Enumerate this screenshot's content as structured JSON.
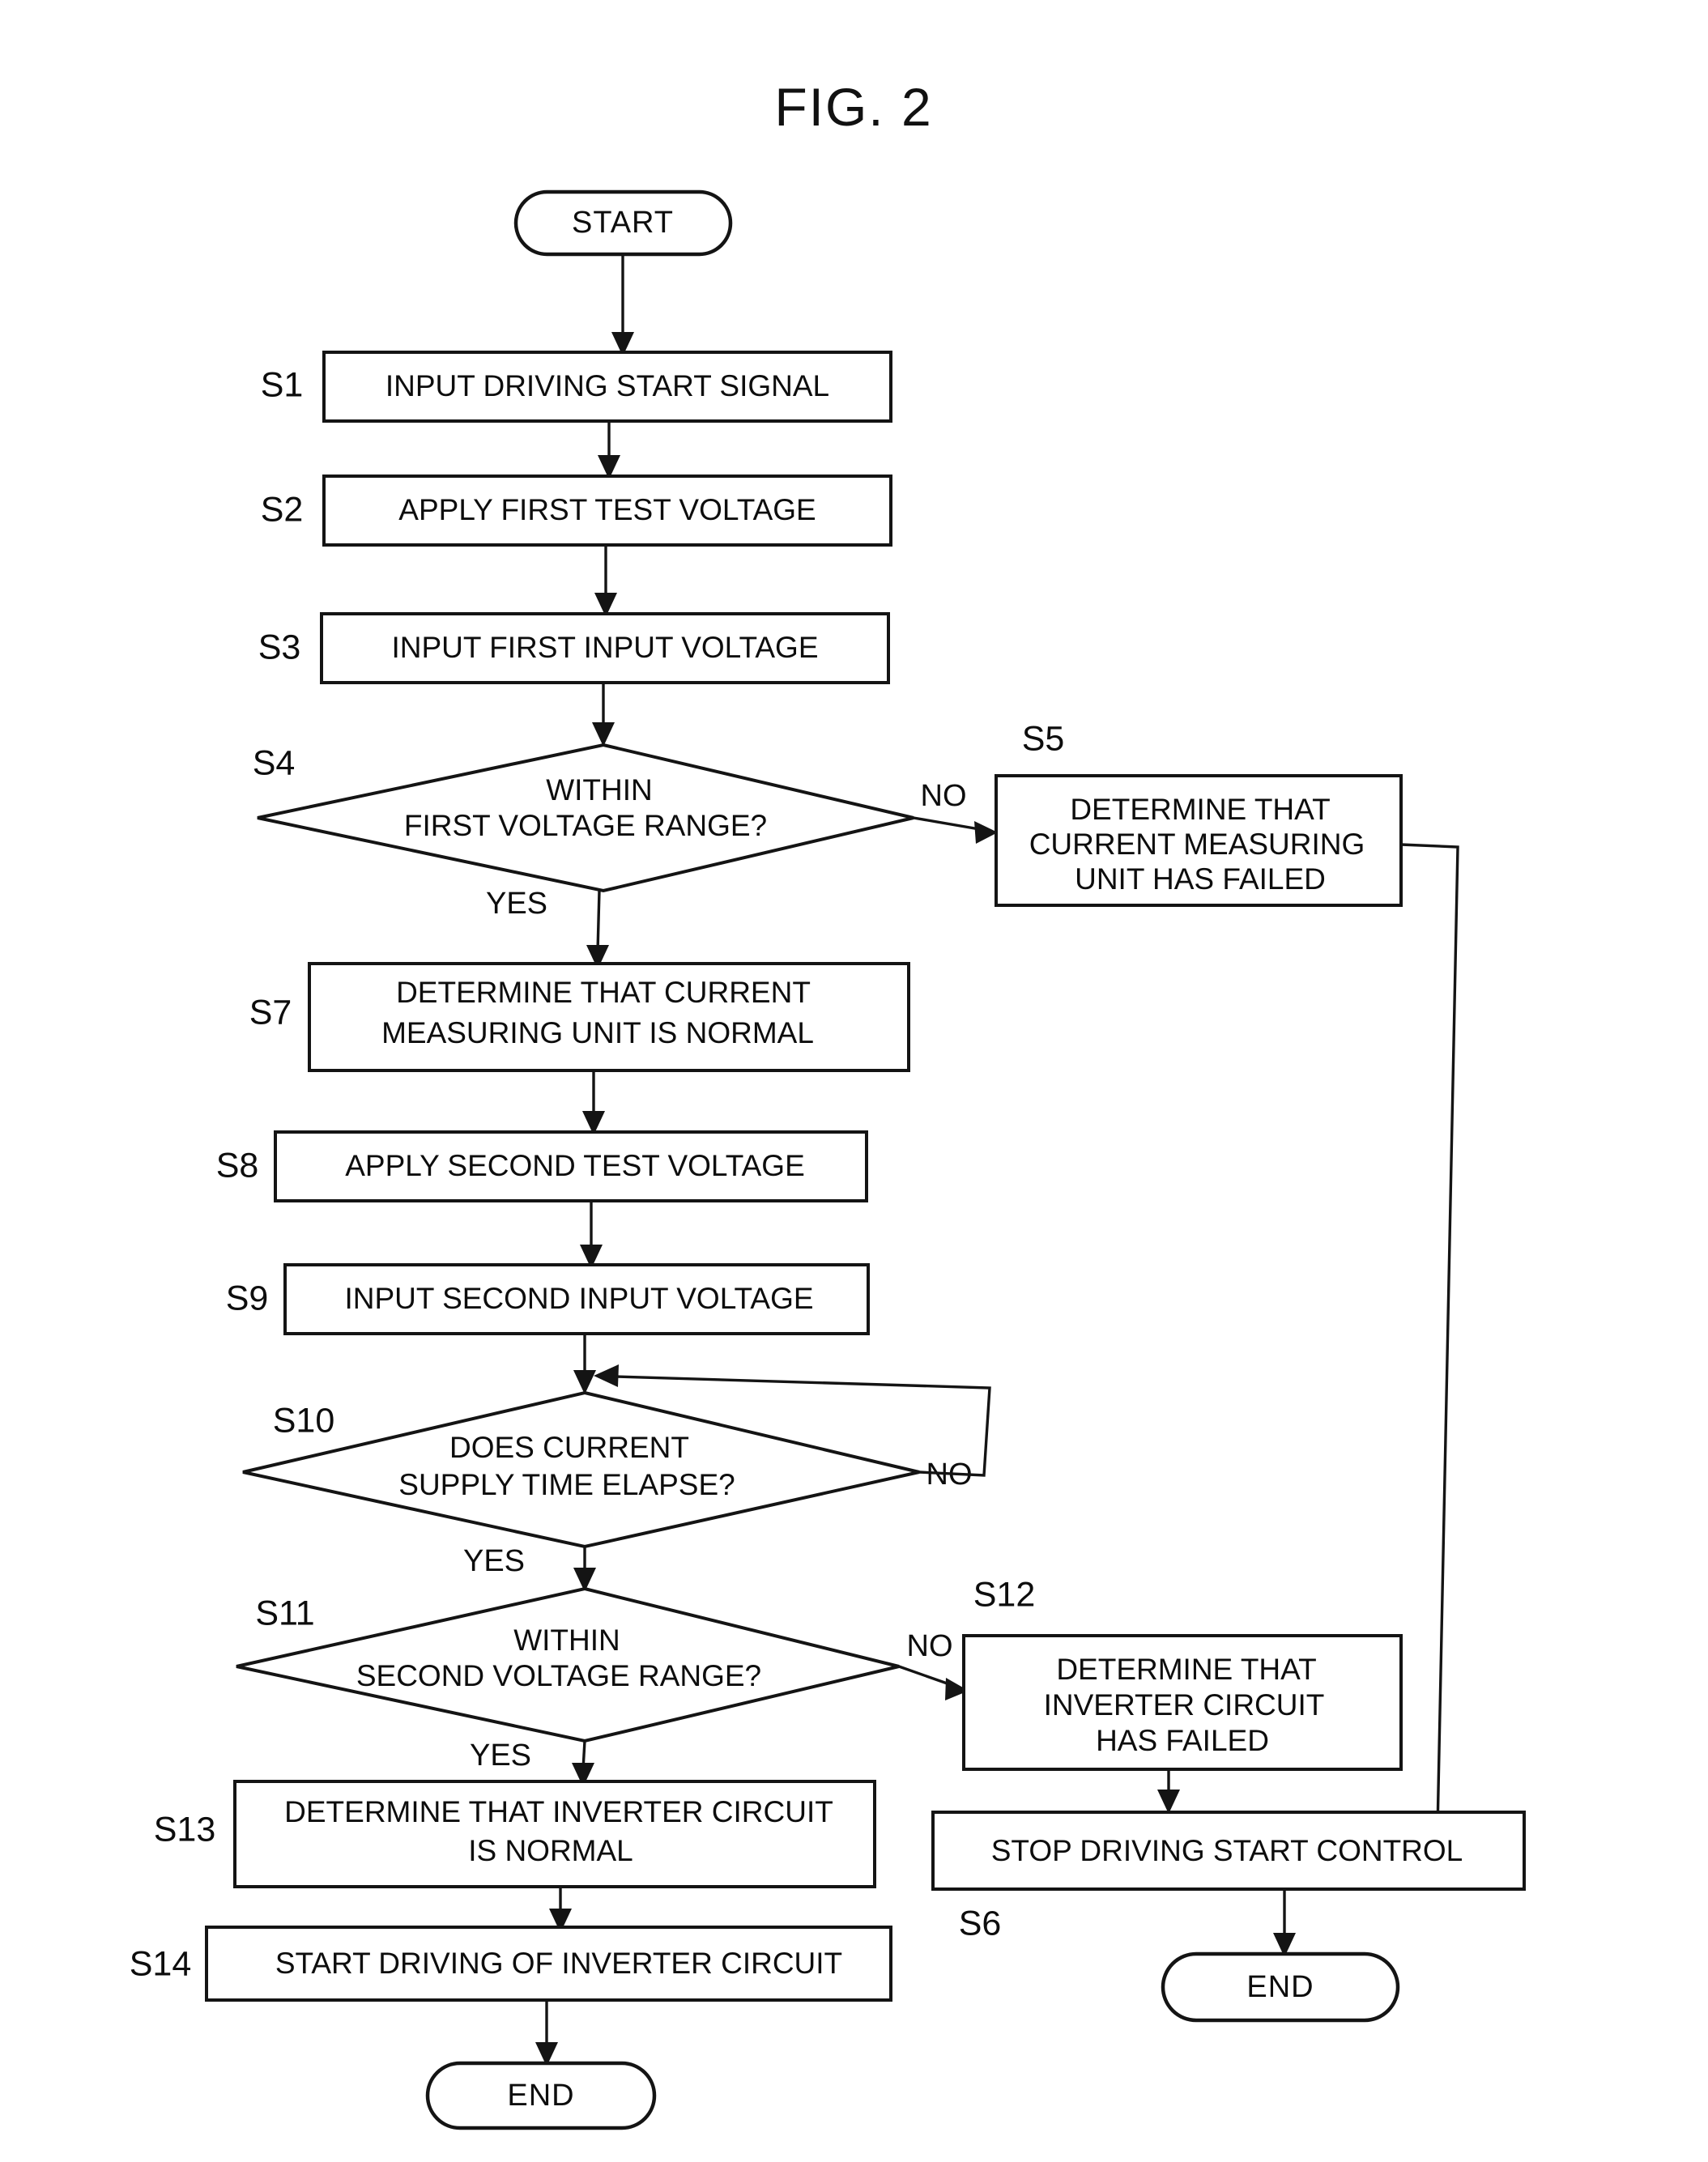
{
  "figure": {
    "title": "FIG. 2",
    "type": "flowchart"
  },
  "nodes": {
    "start": {
      "label": "START",
      "shape": "terminator"
    },
    "s1": {
      "step": "S1",
      "lines": [
        "INPUT DRIVING START SIGNAL"
      ],
      "shape": "process"
    },
    "s2": {
      "step": "S2",
      "lines": [
        "APPLY FIRST TEST VOLTAGE"
      ],
      "shape": "process"
    },
    "s3": {
      "step": "S3",
      "lines": [
        "INPUT FIRST INPUT VOLTAGE"
      ],
      "shape": "process"
    },
    "s4": {
      "step": "S4",
      "lines": [
        "WITHIN",
        "FIRST VOLTAGE RANGE?"
      ],
      "shape": "decision"
    },
    "s5": {
      "step": "S5",
      "lines": [
        "DETERMINE THAT",
        "CURRENT MEASURING",
        "UNIT HAS FAILED"
      ],
      "shape": "process"
    },
    "s7": {
      "step": "S7",
      "lines": [
        "DETERMINE THAT CURRENT",
        "MEASURING UNIT IS NORMAL"
      ],
      "shape": "process"
    },
    "s8": {
      "step": "S8",
      "lines": [
        "APPLY SECOND TEST VOLTAGE"
      ],
      "shape": "process"
    },
    "s9": {
      "step": "S9",
      "lines": [
        "INPUT SECOND INPUT VOLTAGE"
      ],
      "shape": "process"
    },
    "s10": {
      "step": "S10",
      "lines": [
        "DOES CURRENT",
        "SUPPLY TIME ELAPSE?"
      ],
      "shape": "decision"
    },
    "s11": {
      "step": "S11",
      "lines": [
        "WITHIN",
        "SECOND VOLTAGE RANGE?"
      ],
      "shape": "decision"
    },
    "s12": {
      "step": "S12",
      "lines": [
        "DETERMINE THAT",
        "INVERTER CIRCUIT",
        "HAS FAILED"
      ],
      "shape": "process"
    },
    "s13": {
      "step": "S13",
      "lines": [
        "DETERMINE THAT INVERTER CIRCUIT",
        "IS NORMAL"
      ],
      "shape": "process"
    },
    "s14": {
      "step": "S14",
      "lines": [
        "START DRIVING OF INVERTER CIRCUIT"
      ],
      "shape": "process"
    },
    "s6": {
      "step": "S6",
      "lines": [
        "STOP DRIVING START CONTROL"
      ],
      "shape": "process"
    },
    "end_left": {
      "label": "END",
      "shape": "terminator"
    },
    "end_right": {
      "label": "END",
      "shape": "terminator"
    }
  },
  "branch_labels": {
    "s4_no": "NO",
    "s4_yes": "YES",
    "s10_no": "NO",
    "s10_yes": "YES",
    "s11_no": "NO",
    "s11_yes": "YES"
  },
  "chart_data": {
    "type": "flowchart",
    "title": "FIG. 2",
    "nodes": [
      {
        "id": "start",
        "step": null,
        "text": "START",
        "shape": "terminator"
      },
      {
        "id": "s1",
        "step": "S1",
        "text": "INPUT DRIVING START SIGNAL",
        "shape": "process"
      },
      {
        "id": "s2",
        "step": "S2",
        "text": "APPLY FIRST TEST VOLTAGE",
        "shape": "process"
      },
      {
        "id": "s3",
        "step": "S3",
        "text": "INPUT FIRST INPUT VOLTAGE",
        "shape": "process"
      },
      {
        "id": "s4",
        "step": "S4",
        "text": "WITHIN FIRST VOLTAGE RANGE?",
        "shape": "decision"
      },
      {
        "id": "s5",
        "step": "S5",
        "text": "DETERMINE THAT CURRENT MEASURING UNIT HAS FAILED",
        "shape": "process"
      },
      {
        "id": "s7",
        "step": "S7",
        "text": "DETERMINE THAT CURRENT MEASURING UNIT IS NORMAL",
        "shape": "process"
      },
      {
        "id": "s8",
        "step": "S8",
        "text": "APPLY SECOND TEST VOLTAGE",
        "shape": "process"
      },
      {
        "id": "s9",
        "step": "S9",
        "text": "INPUT SECOND INPUT VOLTAGE",
        "shape": "process"
      },
      {
        "id": "s10",
        "step": "S10",
        "text": "DOES CURRENT SUPPLY TIME ELAPSE?",
        "shape": "decision"
      },
      {
        "id": "s11",
        "step": "S11",
        "text": "WITHIN SECOND VOLTAGE RANGE?",
        "shape": "decision"
      },
      {
        "id": "s12",
        "step": "S12",
        "text": "DETERMINE THAT INVERTER CIRCUIT HAS FAILED",
        "shape": "process"
      },
      {
        "id": "s13",
        "step": "S13",
        "text": "DETERMINE THAT INVERTER CIRCUIT IS NORMAL",
        "shape": "process"
      },
      {
        "id": "s14",
        "step": "S14",
        "text": "START DRIVING OF INVERTER CIRCUIT",
        "shape": "process"
      },
      {
        "id": "s6",
        "step": "S6",
        "text": "STOP DRIVING START CONTROL",
        "shape": "process"
      },
      {
        "id": "end_left",
        "step": null,
        "text": "END",
        "shape": "terminator"
      },
      {
        "id": "end_right",
        "step": null,
        "text": "END",
        "shape": "terminator"
      }
    ],
    "edges": [
      {
        "from": "start",
        "to": "s1",
        "label": ""
      },
      {
        "from": "s1",
        "to": "s2",
        "label": ""
      },
      {
        "from": "s2",
        "to": "s3",
        "label": ""
      },
      {
        "from": "s3",
        "to": "s4",
        "label": ""
      },
      {
        "from": "s4",
        "to": "s5",
        "label": "NO"
      },
      {
        "from": "s4",
        "to": "s7",
        "label": "YES"
      },
      {
        "from": "s5",
        "to": "s6",
        "label": ""
      },
      {
        "from": "s7",
        "to": "s8",
        "label": ""
      },
      {
        "from": "s8",
        "to": "s9",
        "label": ""
      },
      {
        "from": "s9",
        "to": "s10",
        "label": ""
      },
      {
        "from": "s10",
        "to": "s10",
        "label": "NO"
      },
      {
        "from": "s10",
        "to": "s11",
        "label": "YES"
      },
      {
        "from": "s11",
        "to": "s12",
        "label": "NO"
      },
      {
        "from": "s11",
        "to": "s13",
        "label": "YES"
      },
      {
        "from": "s12",
        "to": "s6",
        "label": ""
      },
      {
        "from": "s13",
        "to": "s14",
        "label": ""
      },
      {
        "from": "s14",
        "to": "end_left",
        "label": ""
      },
      {
        "from": "s6",
        "to": "end_right",
        "label": ""
      }
    ]
  }
}
